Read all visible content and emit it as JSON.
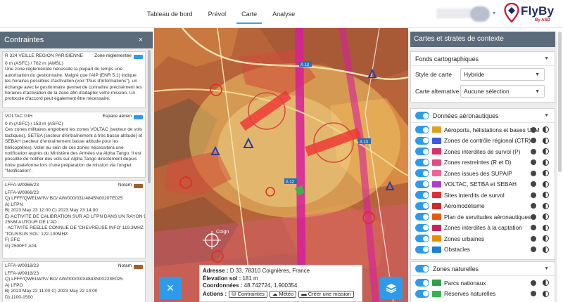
{
  "nav": {
    "tabs": [
      {
        "label": "Tableau de bord"
      },
      {
        "label": "Prévol"
      },
      {
        "label": "Carte"
      },
      {
        "label": "Analyse"
      }
    ],
    "active": "Carte"
  },
  "brand": {
    "name": "FlyBy",
    "by": "By ASD",
    "color": "#1e2a5e",
    "accent": "#c8102e"
  },
  "left_panel": {
    "title": "Contraintes",
    "close": "×",
    "cards": [
      {
        "title": "R 324 VEILLE REGION PARISIENNE",
        "type": "Zone réglementée",
        "type_color": "#2e9bea",
        "alt": "0 m (ASFC) / 762 m (AMSL)",
        "body": "Une zone réglementée nécessite la plupart du temps une autorisation du gestionnaire. Malgré que l'AIP (ENR 5.1) indique les horaires possibles d'activation (voir \"Plus d'informations\"), un échange avec le gestionnaire permet de connaître précisément les horaires d'activation de la zone afin d'adapter votre mission. Un protocole d'accord peut également être nécessaire."
      },
      {
        "title": "VOLTAC GIH",
        "type": "Espace aérien",
        "type_color": "#2e9bea",
        "alt": "0 m (ASFC) / 153 m (ASFC)",
        "body": "Ces zones militaires englobent les zones VOLTAC (secteur de vols tactiques), SETBA (secteur d'entraînement à très basse altitude) et SEBAH (secteur d'entraînement basse altitude pour les hélicoptères). Voler au sein de ces zones nécessitera une notification auprès du Ministère des Armées via Alpha Tango. Il est possible de notifier des vols sur Alpha Tango directement depuis notre plateforme lors d'une préparation de mission via l'onglet \"Notification\"."
      },
      {
        "title": "LFFA-W0966/23",
        "type": "Notam",
        "type_color": "#a0622a",
        "lines": [
          "LFFA-W0966/23",
          "Q) LFFF/QWELW/IV/ BO/ AW/000/031/4845N00207E025",
          "A) LFPN",
          "B) 2023 May 23 12:00 C) 2023 May 23 14:00",
          "E) ACTIVITE DE CALIBRATION SUR AD LFPN DANS UN RAYON DE",
          "25NM AUTOUR DE L'AD :",
          "- ACTIVITE REELLE CONNUE DE 'CHEVREUSE INFO' 119.3MHZ ET",
          "'TOUSSUS SOL' 122.130MHZ",
          "F) SFC",
          "G) 2500FT AGL"
        ]
      },
      {
        "title": "LFFA-W0918/23",
        "type": "Notam",
        "type_color": "#a0622a",
        "lines": [
          "LFFA-W0918/23",
          "Q) LFFF/QWELW/IV/ BO/ AW/000/030/4843N00223E025",
          "A) LFPO",
          "B) 2023 May 22 11:00 C) 2023 May 22 14:00",
          "D) 1100-1500"
        ]
      }
    ]
  },
  "map": {
    "road_labels": [
      "A 13",
      "A 13",
      "A 12"
    ],
    "place_labels": [
      "Coign"
    ],
    "info": {
      "address_label": "Adresse :",
      "address": "D 33, 78310 Coignières, France",
      "elevation_label": "Élevation sol :",
      "elevation": "181 m",
      "coords_label": "Coordonnées :",
      "coords": "48.742724, 1.900354",
      "actions_label": "Actions :",
      "actions": [
        "Contraintes",
        "Météo",
        "Créer une mission"
      ]
    },
    "close_fab": "×",
    "layers_fab": "layers-icon"
  },
  "right_panel": {
    "title": "Cartes et strates de contexte",
    "basemap": {
      "title": "Fonds cartographiques",
      "style_label": "Style de carte",
      "style_value": "Hybride",
      "alt_label": "Carte alternative",
      "alt_value": "Aucune sélection"
    },
    "aero": {
      "title": "Données aéronautiques",
      "layers": [
        {
          "label": "Aéroports, hélistations et bases ULM",
          "color": "#e0a020"
        },
        {
          "label": "Zones de contrôle régional (CTR)",
          "color": "#3b5bdb"
        },
        {
          "label": "Zones interdites de survol (P)",
          "color": "#d6336c"
        },
        {
          "label": "Zones restreintes (R et D)",
          "color": "#e64980"
        },
        {
          "label": "Zones issues des SUPAIP",
          "color": "#f06595"
        },
        {
          "label": "VOLTAC, SETBA et SEBAH",
          "color": "#ae3ec9"
        },
        {
          "label": "Sites interdits de survol",
          "color": "#e03131"
        },
        {
          "label": "Aéromodélisme",
          "color": "#c92a2a"
        },
        {
          "label": "Plan de servitudes aéronautiques",
          "color": "#e8590c"
        },
        {
          "label": "Zones interdites à la captation",
          "color": "#c2255c"
        },
        {
          "label": "Zones urbaines",
          "color": "#f08c00"
        },
        {
          "label": "Obstacles",
          "color": "#1c7ed6"
        }
      ]
    },
    "nature": {
      "title": "Zones naturelles",
      "layers": [
        {
          "label": "Parcs nationaux",
          "color": "#2f9e44"
        },
        {
          "label": "Réserves naturelles",
          "color": "#37b24d"
        }
      ]
    }
  }
}
